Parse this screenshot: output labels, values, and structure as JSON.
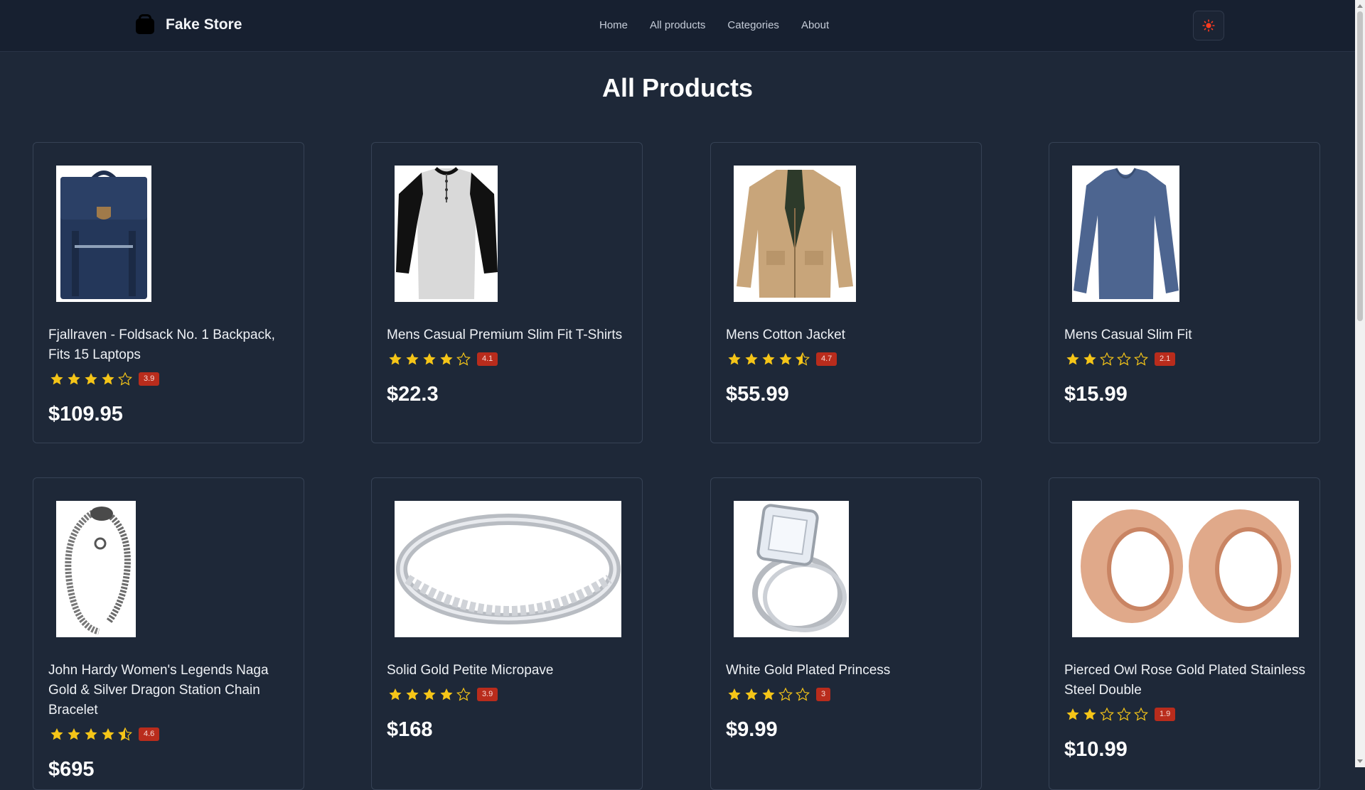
{
  "header": {
    "brand": "Fake Store",
    "nav": [
      "Home",
      "All products",
      "Categories",
      "About"
    ]
  },
  "page_title": "All Products",
  "colors": {
    "background": "#1e2838",
    "navbar": "#172030",
    "star": "#f5c518",
    "badge": "#b92c1c",
    "theme_icon": "#ff3b1f"
  },
  "icons": {
    "brand": "shopping-bag-icon",
    "theme_toggle": "sun-icon",
    "rating": "star-icon"
  },
  "products": [
    {
      "title": "Fjallraven - Foldsack No. 1 Backpack, Fits 15 Laptops",
      "rating": 3.9,
      "rating_label": "3.9",
      "stars_filled": 4,
      "half": false,
      "price": "$109.95",
      "image": "navy backpack"
    },
    {
      "title": "Mens Casual Premium Slim Fit T-Shirts",
      "rating": 4.1,
      "rating_label": "4.1",
      "stars_filled": 4,
      "half": false,
      "price": "$22.3",
      "image": "raglan henley t-shirt"
    },
    {
      "title": "Mens Cotton Jacket",
      "rating": 4.7,
      "rating_label": "4.7",
      "stars_filled": 4,
      "half": true,
      "price": "$55.99",
      "image": "khaki cotton jacket"
    },
    {
      "title": "Mens Casual Slim Fit",
      "rating": 2.1,
      "rating_label": "2.1",
      "stars_filled": 2,
      "half": false,
      "price": "$15.99",
      "image": "blue long sleeve shirt"
    },
    {
      "title": "John Hardy Women's Legends Naga Gold & Silver Dragon Station Chain Bracelet",
      "rating": 4.6,
      "rating_label": "4.6",
      "stars_filled": 4,
      "half": true,
      "price": "$695",
      "image": "silver dragon bracelet"
    },
    {
      "title": "Solid Gold Petite Micropave",
      "rating": 3.9,
      "rating_label": "3.9",
      "stars_filled": 4,
      "half": false,
      "price": "$168",
      "image": "silver micropave ring"
    },
    {
      "title": "White Gold Plated Princess",
      "rating": 3,
      "rating_label": "3",
      "stars_filled": 3,
      "half": false,
      "price": "$9.99",
      "image": "princess cut ring set"
    },
    {
      "title": "Pierced Owl Rose Gold Plated Stainless Steel Double",
      "rating": 1.9,
      "rating_label": "1.9",
      "stars_filled": 2,
      "half": false,
      "price": "$10.99",
      "image": "rose gold tunnel plugs"
    }
  ]
}
